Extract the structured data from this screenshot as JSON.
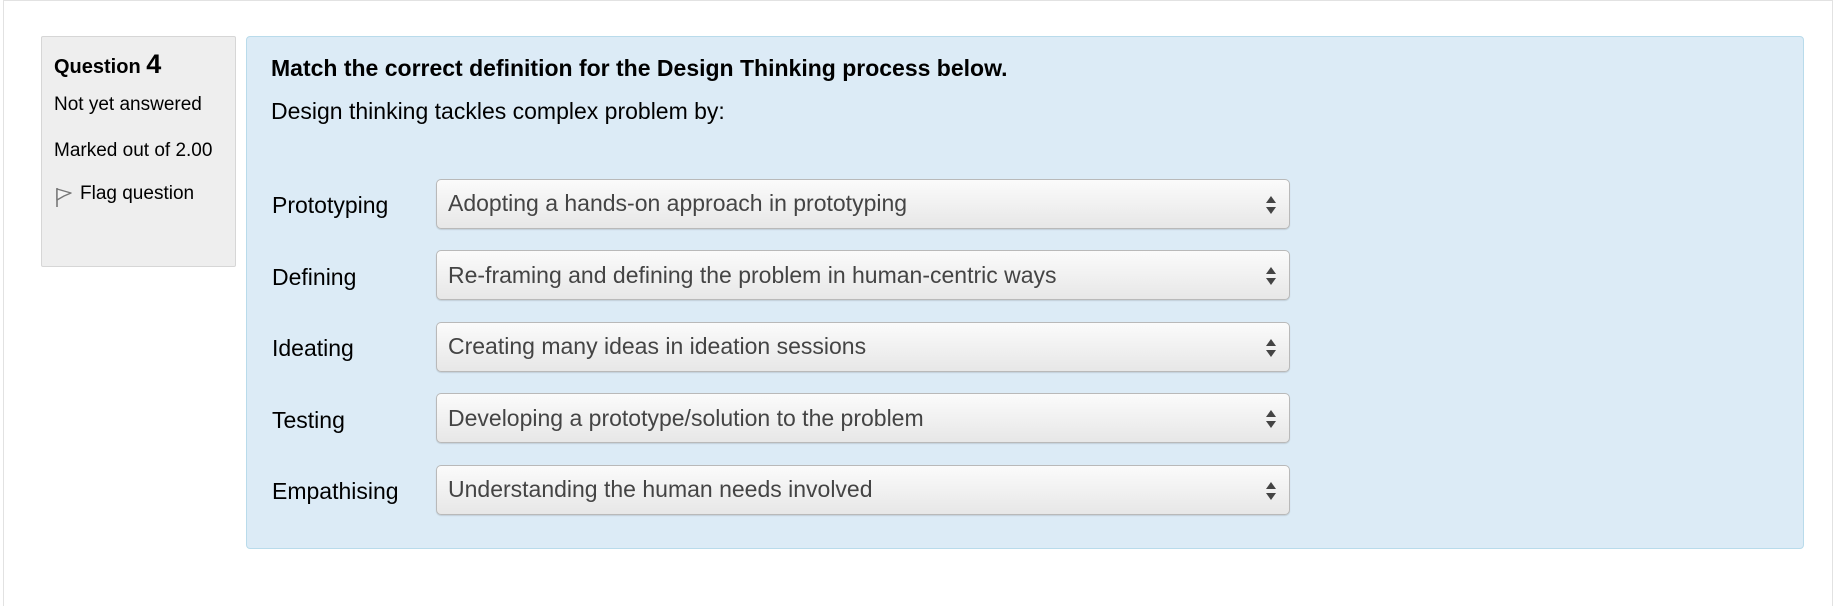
{
  "info": {
    "question_word": "Question",
    "question_number": "4",
    "state": "Not yet answered",
    "grade": "Marked out of 2.00",
    "flag_label": "Flag question",
    "flag_icon": "flag-icon"
  },
  "question": {
    "title": "Match the correct definition for the Design Thinking process below.",
    "prompt": "Design thinking tackles complex problem by:"
  },
  "matches": [
    {
      "label": "Prototyping",
      "selected": "Adopting a hands-on approach in prototyping"
    },
    {
      "label": "Defining",
      "selected": "Re-framing and defining the problem in human-centric ways"
    },
    {
      "label": "Ideating",
      "selected": "Creating many ideas in ideation sessions"
    },
    {
      "label": "Testing",
      "selected": "Developing a prototype/solution to the problem"
    },
    {
      "label": "Empathising",
      "selected": "Understanding the human needs involved"
    }
  ],
  "colors": {
    "info_bg": "#eeeeee",
    "content_bg": "#dcebf6",
    "content_border": "#b9dbeb",
    "select_text": "#444444"
  }
}
